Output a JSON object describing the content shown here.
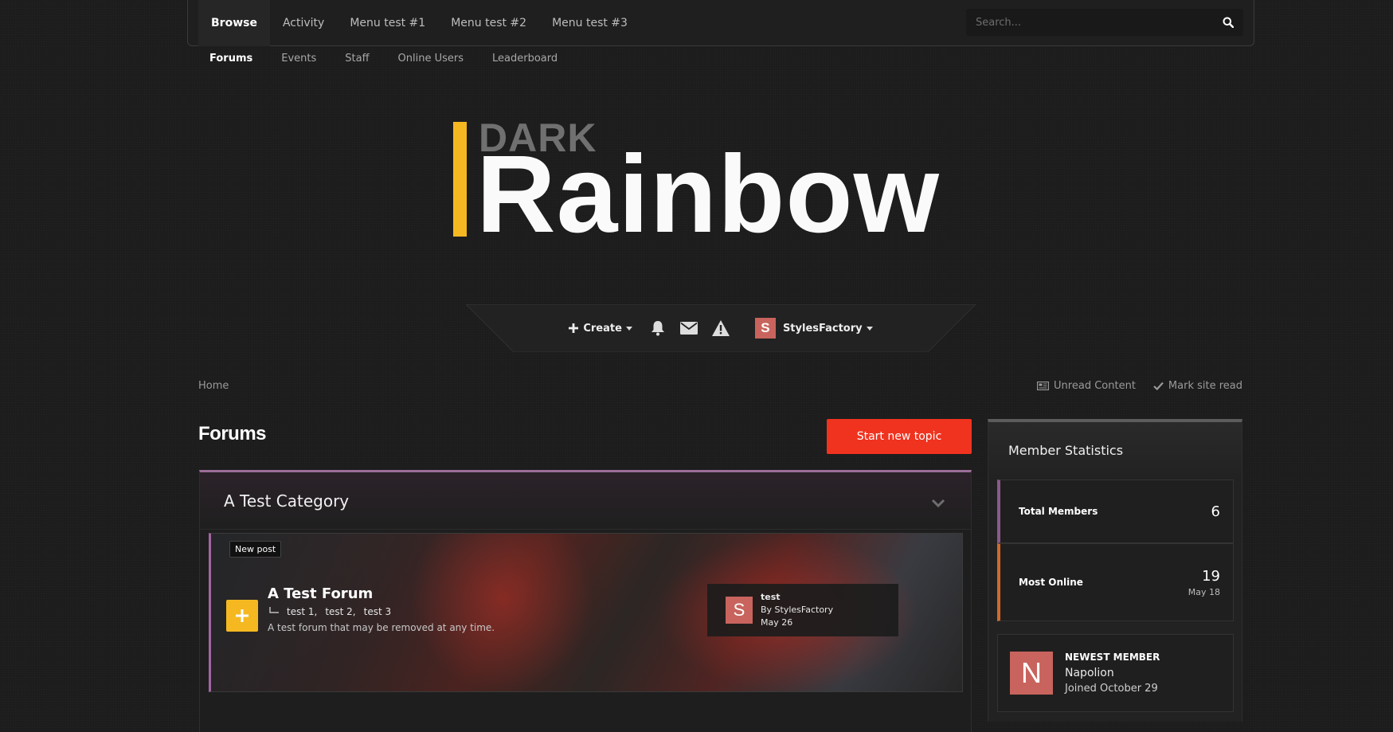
{
  "nav": {
    "items": [
      {
        "label": "Browse",
        "active": true
      },
      {
        "label": "Activity",
        "active": false
      },
      {
        "label": "Menu test #1",
        "active": false
      },
      {
        "label": "Menu test #2",
        "active": false
      },
      {
        "label": "Menu test #3",
        "active": false
      }
    ],
    "search_placeholder": "Search..."
  },
  "subnav": {
    "items": [
      {
        "label": "Forums",
        "active": true
      },
      {
        "label": "Events",
        "active": false
      },
      {
        "label": "Staff",
        "active": false
      },
      {
        "label": "Online Users",
        "active": false
      },
      {
        "label": "Leaderboard",
        "active": false
      }
    ]
  },
  "logo": {
    "top": "DARK",
    "main": "Rainbow",
    "accent_color": "#f5b821"
  },
  "userbar": {
    "create_label": "Create",
    "icons": [
      "bell-icon",
      "envelope-icon",
      "warning-icon"
    ],
    "user_initial": "S",
    "username": "StylesFactory"
  },
  "breadcrumb": {
    "home": "Home"
  },
  "actions": {
    "unread": "Unread Content",
    "mark_read": "Mark site read"
  },
  "page": {
    "title": "Forums",
    "start_topic": "Start new topic"
  },
  "category": {
    "title": "A Test Category",
    "accent_color": "#9b6d99",
    "forum": {
      "badge": "New post",
      "name": "A Test Forum",
      "subforums": [
        "test 1,",
        "test 2,",
        "test 3"
      ],
      "description": "A test forum that may be removed at any time.",
      "last_post": {
        "avatar_initial": "S",
        "title": "test",
        "by": "By StylesFactory",
        "date": "May 26"
      }
    }
  },
  "widget": {
    "title": "Member Statistics",
    "total_members_label": "Total Members",
    "total_members_value": "6",
    "most_online_label": "Most Online",
    "most_online_value": "19",
    "most_online_date": "May 18",
    "newest_label": "NEWEST MEMBER",
    "newest_initial": "N",
    "newest_name": "Napolion",
    "newest_joined": "Joined October 29"
  },
  "colors": {
    "brand_red": "#f0331f",
    "avatar": "#c8645d"
  }
}
